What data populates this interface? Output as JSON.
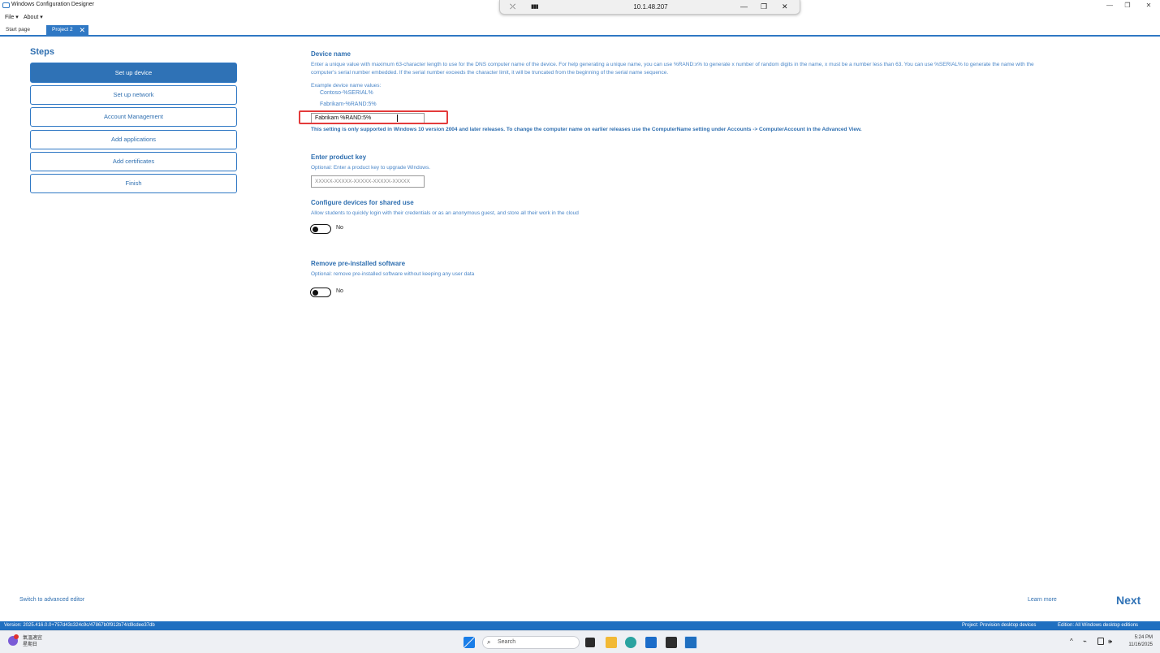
{
  "window": {
    "title": "Windows Configuration Designer",
    "min_glyph": "—",
    "restore_glyph": "❐",
    "close_glyph": "✕"
  },
  "menu": {
    "file": "File ▾",
    "about": "About ▾"
  },
  "rdp": {
    "address": "10.1.48.207",
    "pin_glyph": "⤫",
    "signal_glyph": "▮▮▮",
    "min_glyph": "—",
    "restore_glyph": "❐",
    "close_glyph": "✕"
  },
  "tabs": [
    {
      "label": "Start page"
    },
    {
      "label": "Project 2",
      "close_glyph": "✕"
    }
  ],
  "steps": {
    "title": "Steps",
    "items": [
      {
        "label": "Set up device"
      },
      {
        "label": "Set up network"
      },
      {
        "label": "Account Management"
      },
      {
        "label": "Add applications"
      },
      {
        "label": "Add certificates"
      },
      {
        "label": "Finish"
      }
    ]
  },
  "device_name": {
    "title": "Device name",
    "description_1": "Enter a unique value with maximum 63-character length to use for the DNS computer name of the device. For help generating a unique name, you can use %RAND:x% to generate x number of random digits in the name, x must be a number less than 63. You can use %SERIAL% to generate the name with the",
    "description_2": "computer's serial number embedded. If the serial number exceeds the character limit, it will be truncated from the beginning of the serial name sequence.",
    "examples_label": "Example device name values:",
    "example_1": "Contoso-%SERIAL%",
    "example_2": "Fabrikam-%RAND:5%",
    "value": "Fabrikam %RAND:5%",
    "warning": "This setting is only supported in Windows 10 version 2004 and later releases. To change the computer name on earlier releases use the ComputerName setting under Accounts -> ComputerAccount in the Advanced View."
  },
  "product_key": {
    "title": "Enter product key",
    "description": "Optional: Enter a product key to upgrade Windows.",
    "placeholder": "XXXXX-XXXXX-XXXXX-XXXXX-XXXXX"
  },
  "shared_use": {
    "title": "Configure devices for shared use",
    "description": "Allow students to quickly login with their credentials or as an anonymous guest, and store all their work in the cloud",
    "toggle_label": "No"
  },
  "remove_software": {
    "title": "Remove pre-installed software",
    "description": "Optional: remove pre-installed software without keeping any user data",
    "toggle_label": "No"
  },
  "footer": {
    "switch_advanced": "Switch to advanced editor",
    "learn_more": "Learn more",
    "next": "Next"
  },
  "statusbar": {
    "version": "Version: 2025.416.0.0+757d43c324c9c/47867b0f912b74/d9cdee37db",
    "project": "Project: Provision desktop devices",
    "edition": "Edition: All Windows desktop editions"
  },
  "taskbar": {
    "weather_line1": "氣溫適宜",
    "weather_line2": "星期日",
    "search_placeholder": "Search",
    "search_glyph": "⌕",
    "tray_chevron": "^",
    "tray_network": "⌁",
    "tray_sound": "🕪",
    "clock_time": "5:24 PM",
    "clock_date": "11/16/2025"
  },
  "colors": {
    "accent": "#2f78c4",
    "highlight": "#e33b3b",
    "status_bar": "#1f6fc0"
  }
}
